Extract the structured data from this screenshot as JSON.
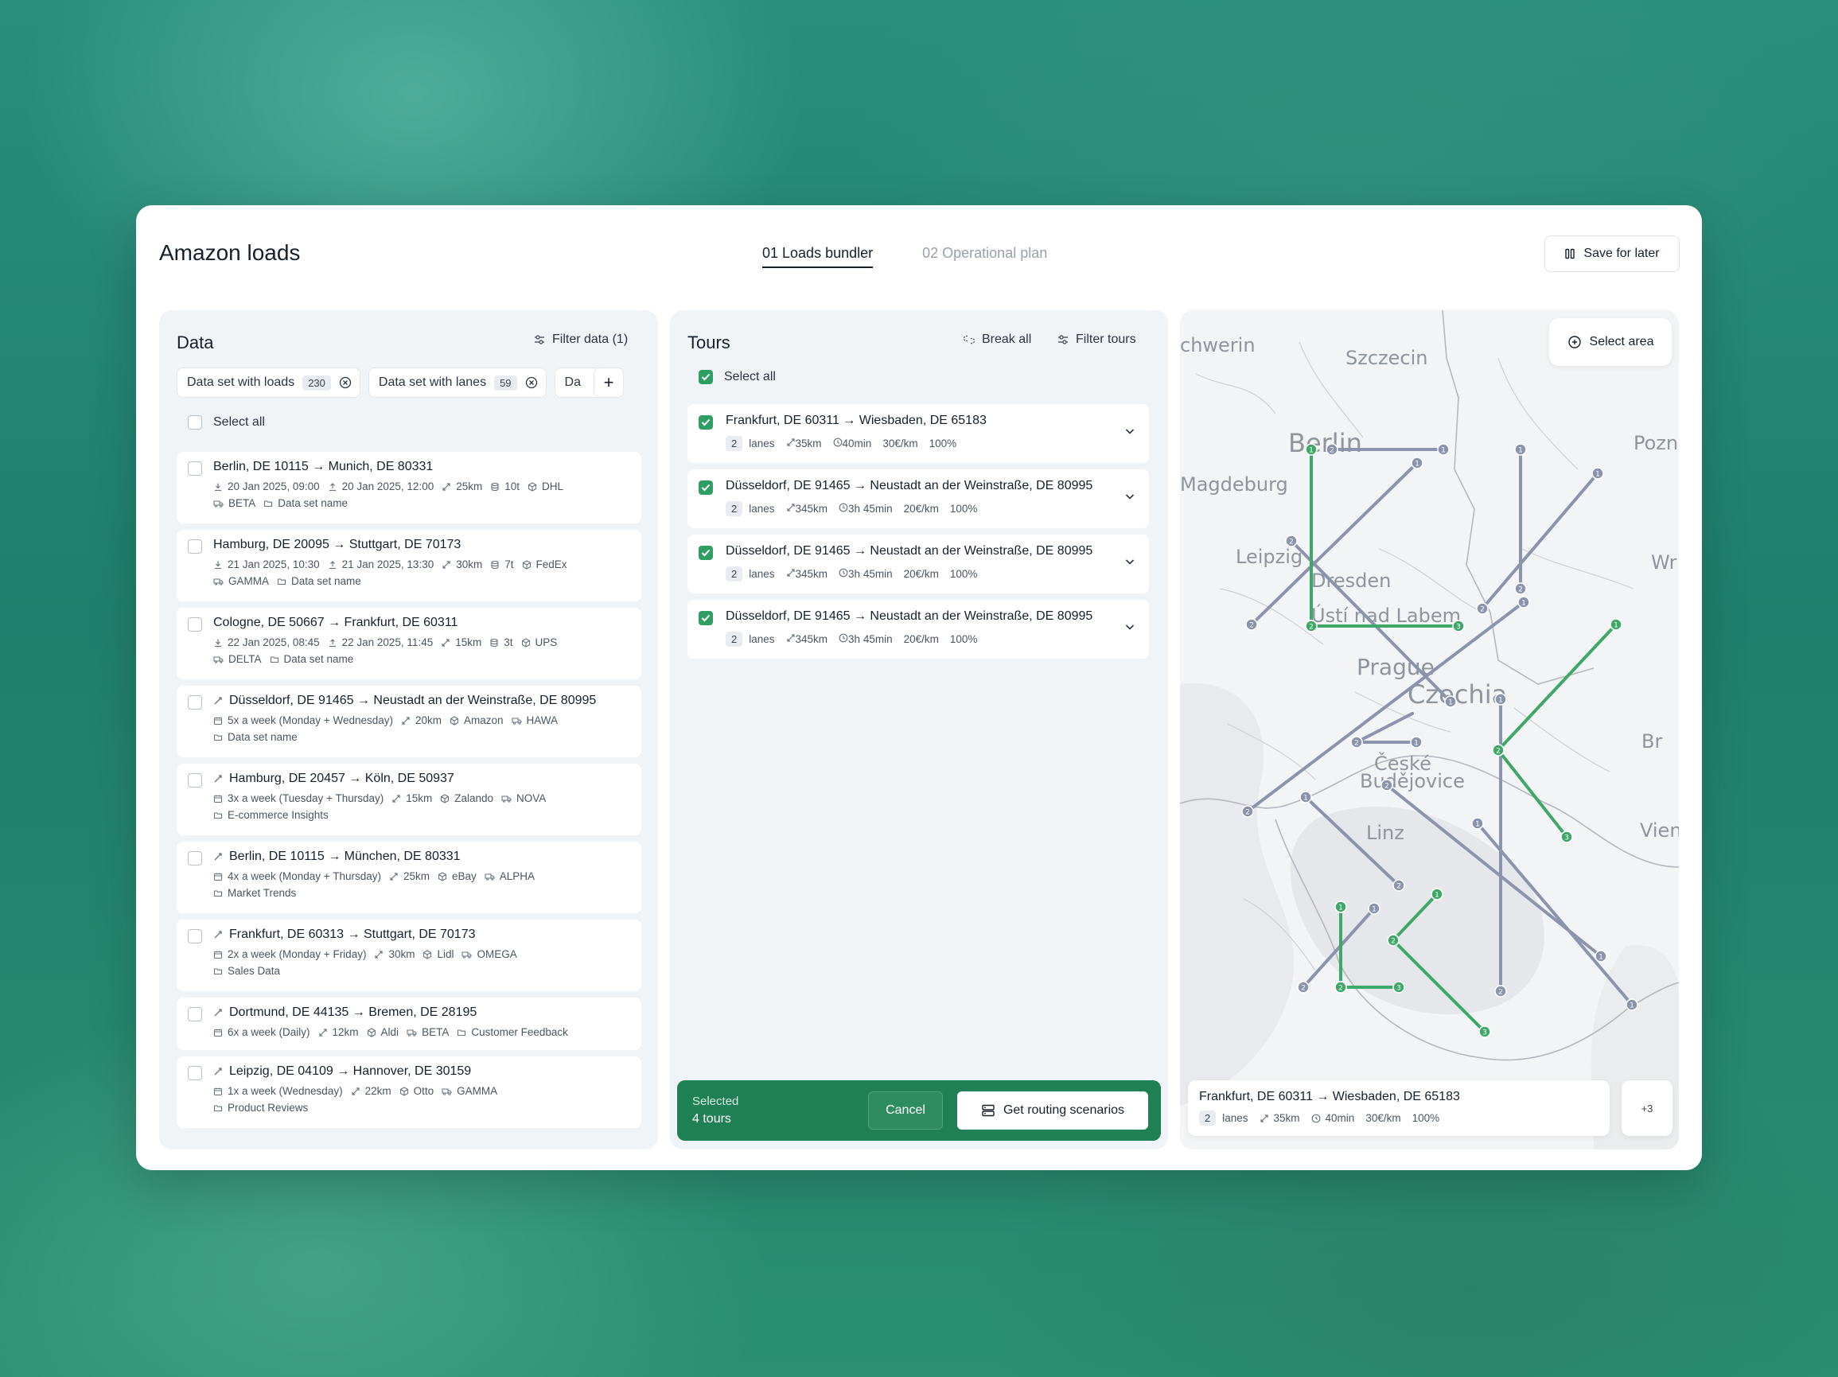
{
  "header": {
    "title": "Amazon loads",
    "steps": [
      {
        "label": "01 Loads bundler",
        "active": true
      },
      {
        "label": "02 Operational plan",
        "active": false
      }
    ],
    "save_label": "Save for later"
  },
  "data_panel": {
    "title": "Data",
    "filter_label": "Filter data (1)",
    "chips": [
      {
        "label": "Data set with loads",
        "count": "230"
      },
      {
        "label": "Data set with lanes",
        "count": "59"
      },
      {
        "label": "Da"
      }
    ],
    "select_all": "Select all",
    "loads": [
      {
        "route": "Berlin, DE 10115 → Munich, DE 80331",
        "pickup": "20 Jan 2025, 09:00",
        "delivery": "20 Jan 2025, 12:00",
        "distance": "25km",
        "weight": "10t",
        "carrier": "DHL",
        "tag": "BETA",
        "dataset": "Data set name"
      },
      {
        "route": "Hamburg, DE 20095 → Stuttgart, DE 70173",
        "pickup": "21 Jan 2025, 10:30",
        "delivery": "21 Jan 2025, 13:30",
        "distance": "30km",
        "weight": "7t",
        "carrier": "FedEx",
        "tag": "GAMMA",
        "dataset": "Data set name"
      },
      {
        "route": "Cologne, DE 50667 → Frankfurt, DE 60311",
        "pickup": "22 Jan 2025, 08:45",
        "delivery": "22 Jan 2025, 11:45",
        "distance": "15km",
        "weight": "3t",
        "carrier": "UPS",
        "tag": "DELTA",
        "dataset": "Data set name"
      }
    ],
    "lanes": [
      {
        "route": "Düsseldorf, DE 91465 → Neustadt an der Weinstraße, DE 80995",
        "frequency": "5x a week (Monday + Wednesday)",
        "distance": "20km",
        "shipper": "Amazon",
        "tag": "HAWA",
        "dataset": "Data set name"
      },
      {
        "route": "Hamburg, DE 20457 → Köln, DE 50937",
        "frequency": "3x a week (Tuesday + Thursday)",
        "distance": "15km",
        "shipper": "Zalando",
        "tag": "NOVA",
        "dataset": "E-commerce Insights"
      },
      {
        "route": "Berlin, DE 10115 → München, DE 80331",
        "frequency": "4x a week (Monday + Thursday)",
        "distance": "25km",
        "shipper": "eBay",
        "tag": "ALPHA",
        "dataset": "Market Trends"
      },
      {
        "route": "Frankfurt, DE 60313 → Stuttgart, DE 70173",
        "frequency": "2x a week (Monday + Friday)",
        "distance": "30km",
        "shipper": "Lidl",
        "tag": "OMEGA",
        "dataset": "Sales Data"
      },
      {
        "route": "Dortmund, DE 44135 → Bremen, DE 28195",
        "frequency": "6x a week (Daily)",
        "distance": "12km",
        "shipper": "Aldi",
        "tag": "BETA",
        "dataset": "Customer Feedback",
        "inline": true
      },
      {
        "route": "Leipzig, DE 04109 → Hannover, DE 30159",
        "frequency": "1x a week (Wednesday)",
        "distance": "22km",
        "shipper": "Otto",
        "tag": "GAMMA",
        "dataset": "Product Reviews"
      }
    ]
  },
  "tours_panel": {
    "title": "Tours",
    "break_all": "Break all",
    "filter_label": "Filter tours",
    "select_all": "Select all",
    "tours": [
      {
        "route": "Frankfurt, DE 60311 → Wiesbaden, DE 65183",
        "lanes_count": "2",
        "lanes_label": "lanes",
        "distance": "35km",
        "duration": "40min",
        "rate": "30€/km",
        "fill": "100%"
      },
      {
        "route": "Düsseldorf, DE 91465 → Neustadt an der Weinstraße, DE 80995",
        "lanes_count": "2",
        "lanes_label": "lanes",
        "distance": "345km",
        "duration": "3h 45min",
        "rate": "20€/km",
        "fill": "100%"
      },
      {
        "route": "Düsseldorf, DE 91465 → Neustadt an der Weinstraße, DE 80995",
        "lanes_count": "2",
        "lanes_label": "lanes",
        "distance": "345km",
        "duration": "3h 45min",
        "rate": "20€/km",
        "fill": "100%"
      },
      {
        "route": "Düsseldorf, DE 91465 → Neustadt an der Weinstraße, DE 80995",
        "lanes_count": "2",
        "lanes_label": "lanes",
        "distance": "345km",
        "duration": "3h 45min",
        "rate": "20€/km",
        "fill": "100%"
      }
    ],
    "selection": {
      "label": "Selected",
      "value": "4 tours"
    },
    "cancel_label": "Cancel",
    "routing_label": "Get routing scenarios"
  },
  "map": {
    "select_area": "Select area",
    "cities": [
      "chwerin",
      "Szczecin",
      "Berlin",
      "Pozn",
      "Magdeburg",
      "Leipzig",
      "Wr",
      "Dresden",
      "Ústí nad Labem",
      "Prague",
      "Czechia",
      "Br",
      "České",
      "Budějovice",
      "Linz",
      "Vienn"
    ],
    "card": {
      "route": "Frankfurt, DE 60311 → Wiesbaden, DE 65183",
      "lanes_count": "2",
      "lanes_label": "lanes",
      "distance": "35km",
      "duration": "40min",
      "rate": "30€/km",
      "fill": "100%"
    },
    "more": "+3",
    "colors": {
      "lane": "#8b93ad",
      "tour": "#3fa868"
    }
  }
}
